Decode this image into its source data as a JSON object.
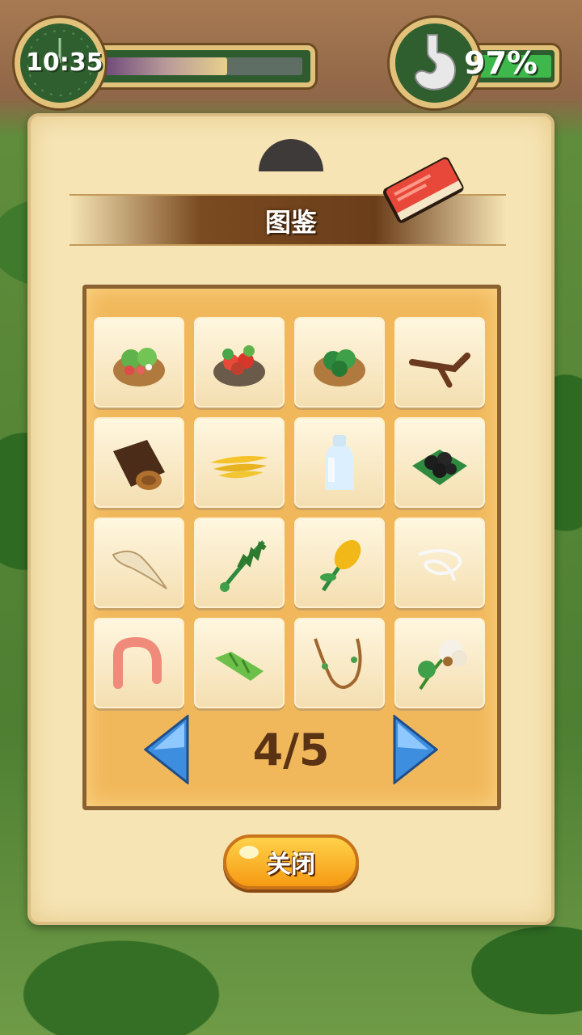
{
  "hud": {
    "time": "10:35",
    "day_progress": 0.62,
    "hunger_percent": "97%",
    "clock_icon": "clock-icon",
    "stomach_icon": "stomach-icon"
  },
  "panel": {
    "title": "图鉴",
    "book_icon": "book-icon"
  },
  "items": [
    {
      "icon": "salad-bowl-icon"
    },
    {
      "icon": "seafood-bowl-icon"
    },
    {
      "icon": "greens-bowl-icon"
    },
    {
      "icon": "branch-icon"
    },
    {
      "icon": "log-icon"
    },
    {
      "icon": "banana-bunch-icon"
    },
    {
      "icon": "milk-bottle-icon"
    },
    {
      "icon": "berries-icon"
    },
    {
      "icon": "root-icon"
    },
    {
      "icon": "fern-icon"
    },
    {
      "icon": "grain-icon"
    },
    {
      "icon": "rope-icon"
    },
    {
      "icon": "worm-icon"
    },
    {
      "icon": "bamboo-icon"
    },
    {
      "icon": "vine-icon"
    },
    {
      "icon": "cotton-icon"
    }
  ],
  "pager": {
    "text": "4/5",
    "prev_icon": "arrow-left-icon",
    "next_icon": "arrow-right-icon"
  },
  "close_button": {
    "label": "关闭"
  },
  "colors": {
    "accent": "#f59a12",
    "banner": "#6b3e1a",
    "frame": "#f1b85b"
  }
}
